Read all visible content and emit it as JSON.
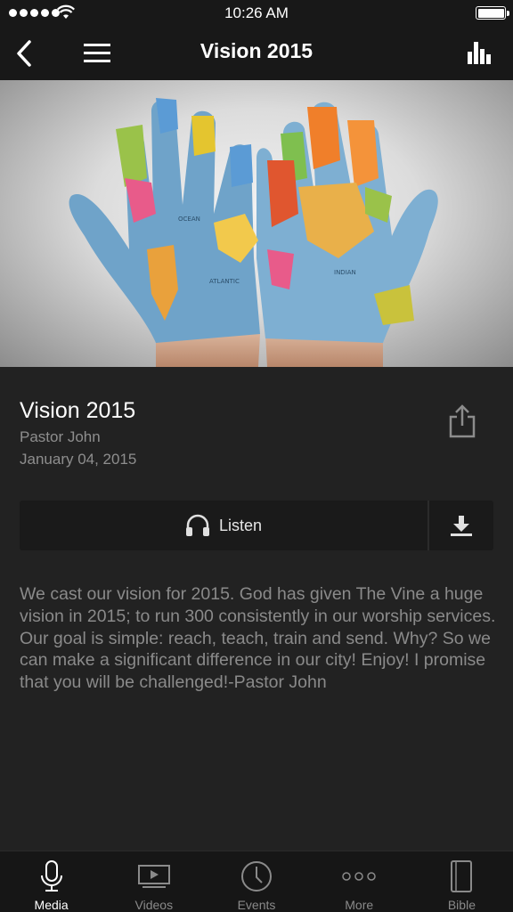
{
  "status_bar": {
    "time": "10:26 AM"
  },
  "nav": {
    "title": "Vision 2015"
  },
  "sermon": {
    "title": "Vision 2015",
    "speaker": "Pastor John",
    "date": "January 04, 2015",
    "description": "We cast our vision for 2015. God has given The Vine a huge vision in 2015; to run 300 consistently in our worship services. Our goal is simple: reach, teach, train and send. Why? So we can make a significant difference in our city! Enjoy! I promise that you will be challenged!-Pastor John"
  },
  "listen": {
    "label": "Listen"
  },
  "tabs": [
    {
      "label": "Media",
      "icon": "microphone-icon",
      "active": true
    },
    {
      "label": "Videos",
      "icon": "video-player-icon",
      "active": false
    },
    {
      "label": "Events",
      "icon": "clock-icon",
      "active": false
    },
    {
      "label": "More",
      "icon": "more-dots-icon",
      "active": false
    },
    {
      "label": "Bible",
      "icon": "book-icon",
      "active": false
    }
  ],
  "colors": {
    "background": "#222222",
    "bars": "#181818",
    "secondary_text": "#8a8a8a"
  }
}
